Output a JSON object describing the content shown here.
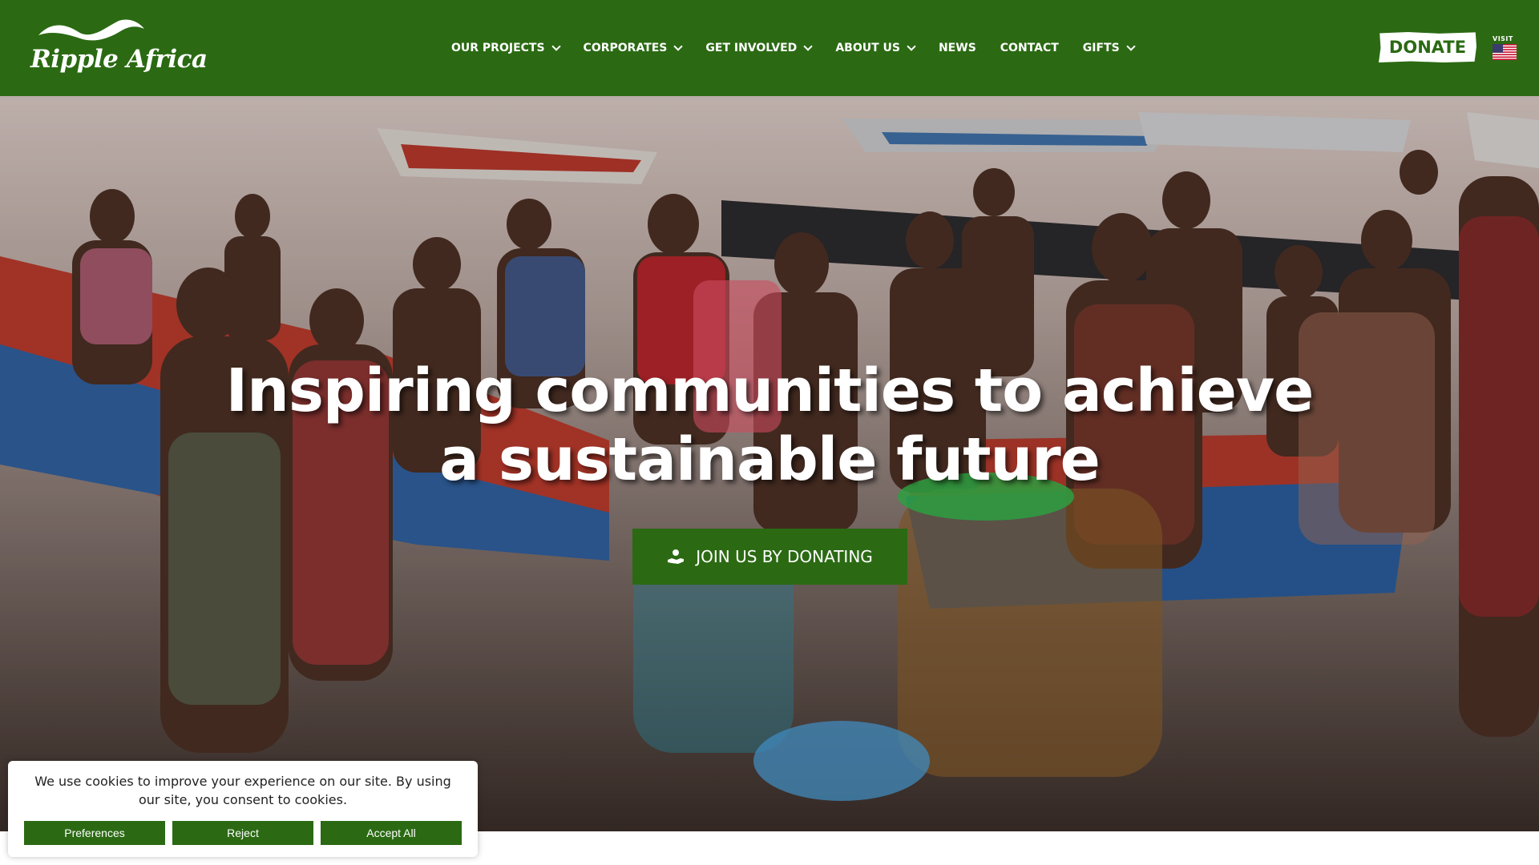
{
  "header": {
    "logo_text": "Ripple Africa",
    "nav": [
      {
        "label": "OUR PROJECTS",
        "has_dropdown": true
      },
      {
        "label": "CORPORATES",
        "has_dropdown": true
      },
      {
        "label": "GET INVOLVED",
        "has_dropdown": true
      },
      {
        "label": "ABOUT US",
        "has_dropdown": true
      },
      {
        "label": "NEWS",
        "has_dropdown": false
      },
      {
        "label": "CONTACT",
        "has_dropdown": false
      },
      {
        "label": "GIFTS",
        "has_dropdown": true
      }
    ],
    "donate_label": "DONATE",
    "visit_label": "VISIT",
    "visit_flag_icon": "us-flag-icon"
  },
  "hero": {
    "title": "Inspiring communities to achieve a sustainable future",
    "cta_label": "JOIN US BY DONATING",
    "cta_icon": "hand-heart-icon"
  },
  "cookie_banner": {
    "message": "We use cookies to improve your experience on our site. By using our site, you consent to cookies.",
    "preferences_label": "Preferences",
    "reject_label": "Reject",
    "accept_label": "Accept All"
  },
  "colors": {
    "brand_green": "#2b6a13",
    "white": "#ffffff"
  }
}
